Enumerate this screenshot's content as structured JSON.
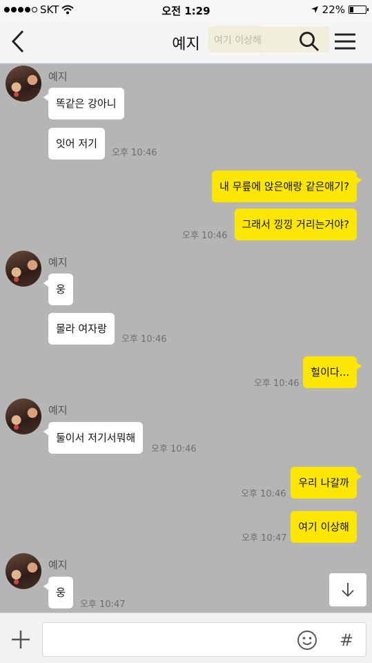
{
  "status_bar": {
    "carrier": "SKT",
    "time": "오전 1:29",
    "battery": "22%",
    "battery_level": 0.22
  },
  "header": {
    "title": "예지",
    "faded_preview": "여기 이상해"
  },
  "messages": [
    {
      "sender": "예지",
      "text": "똑같은 강아니",
      "time": ""
    },
    {
      "sender": "예지",
      "text": "잇어 저기",
      "time": "오후 10:46"
    },
    {
      "sender": "me",
      "text": "내 무릎에 앉은애랑 같은애기?",
      "time": ""
    },
    {
      "sender": "me",
      "text": "그래서 낑낑 거리는거야?",
      "time": "오후 10:46"
    },
    {
      "sender": "예지",
      "text": "웅",
      "time": ""
    },
    {
      "sender": "예지",
      "text": "몰라 여자랑",
      "time": "오후 10:46"
    },
    {
      "sender": "me",
      "text": "헐이다...",
      "time": "오후 10:46"
    },
    {
      "sender": "예지",
      "text": "둘이서 저기서뭐해",
      "time": "오후 10:46"
    },
    {
      "sender": "me",
      "text": "우리 나갈까",
      "time": "오후 10:46"
    },
    {
      "sender": "me",
      "text": "여기 이상해",
      "time": "오후 10:47"
    },
    {
      "sender": "예지",
      "text": "웅",
      "time": "오후 10:47"
    }
  ],
  "input": {
    "placeholder": "",
    "value": "",
    "hash_label": "#"
  },
  "colors": {
    "outgoing_bubble": "#fde600",
    "incoming_bubble": "#ffffff",
    "chat_background": "#b5b5b5"
  }
}
